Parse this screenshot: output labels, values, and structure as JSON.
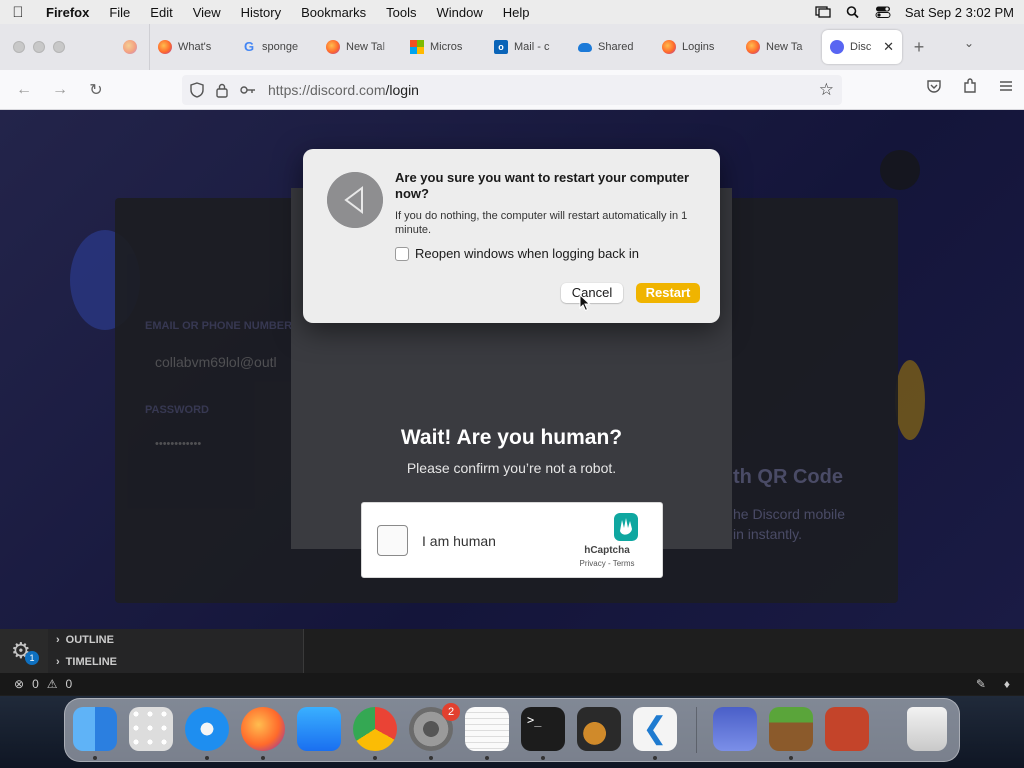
{
  "menubar": {
    "app_name": "Firefox",
    "menus": [
      "File",
      "Edit",
      "View",
      "History",
      "Bookmarks",
      "Tools",
      "Window",
      "Help"
    ],
    "clock": "Sat Sep 2  3:02 PM"
  },
  "tabs": [
    {
      "label": "What's",
      "icon": "firefox-icon"
    },
    {
      "label": "sponge",
      "icon": "google-icon"
    },
    {
      "label": "New Tal",
      "icon": "firefox-icon"
    },
    {
      "label": "Micros",
      "icon": "microsoft-icon"
    },
    {
      "label": "Mail - c",
      "icon": "outlook-icon"
    },
    {
      "label": "Shared",
      "icon": "onedrive-icon"
    },
    {
      "label": "Logins",
      "icon": "firefox-icon"
    },
    {
      "label": "New Ta",
      "icon": "firefox-icon"
    },
    {
      "label": "Disc",
      "icon": "discord-icon",
      "active": true
    }
  ],
  "nav": {
    "url_host": "https://discord.com",
    "url_path": "/login"
  },
  "dialog": {
    "title": "Are you sure you want to restart your computer now?",
    "body": "If you do nothing, the computer will restart automatically in 1 minute.",
    "checkbox_label": "Reopen windows when logging back in",
    "checkbox_checked": false,
    "cancel_label": "Cancel",
    "restart_label": "Restart",
    "restart_color": "#f0b400"
  },
  "captcha": {
    "title": "Wait! Are you human?",
    "subtitle": "Please confirm you’re not a robot.",
    "checkbox_label": "I am human",
    "brand": "hCaptcha",
    "links": "Privacy - Terms"
  },
  "background_page": {
    "email_label": "EMAIL OR PHONE NUMBER",
    "email_value": "collabvm69lol@outl",
    "password_label": "PASSWORD",
    "password_value": "••••••••••••",
    "qr_title": "th QR Code",
    "qr_line1": "he Discord mobile",
    "qr_line2": "in instantly."
  },
  "vscode": {
    "sections": [
      "OUTLINE",
      "TIMELINE"
    ],
    "gear_badge": "1",
    "errors": "0",
    "warnings": "0"
  },
  "dock": {
    "settings_badge": "2",
    "apps": [
      "Finder",
      "Launchpad",
      "Safari",
      "Firefox",
      "App Store",
      "Chrome",
      "System Settings",
      "TextEdit",
      "Terminal",
      "GarageBand",
      "Visual Studio Code",
      "Weather",
      "Minecraft",
      "Photo Booth",
      "Trash"
    ]
  }
}
